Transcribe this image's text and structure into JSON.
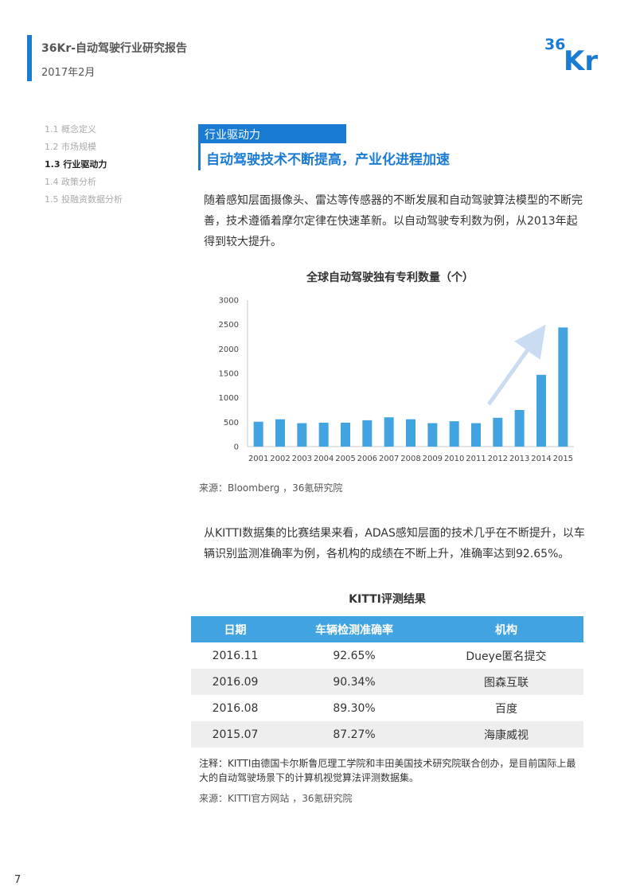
{
  "header": {
    "title": "36Kr-自动驾驶行业研究报告",
    "date": "2017年2月",
    "logo_top": "36",
    "logo_main": "Kr",
    "logo_color": "#1a7bd3"
  },
  "toc": [
    {
      "label": "1.1 概念定义"
    },
    {
      "label": "1.2 市场规模"
    },
    {
      "label": "1.3 行业驱动力"
    },
    {
      "label": "1.4 政策分析"
    },
    {
      "label": "1.5 投融资数据分析"
    }
  ],
  "section": {
    "label": "行业驱动力",
    "title": "自动驾驶技术不断提高，产业化进程加速"
  },
  "paragraphs": {
    "p1": "随着感知层面摄像头、雷达等传感器的不断发展和自动驾驶算法模型的不断完善，技术遵循着摩尔定律在快速革新。以自动驾驶专利数为例，从2013年起得到较大提升。",
    "p2": "从KITTI数据集的比赛结果来看，ADAS感知层面的技术几乎在不断提升，以车辆识别监测准确率为例，各机构的成绩在不断上升，准确率达到92.65%。"
  },
  "chart_data": {
    "type": "bar",
    "title": "全球自动驾驶独有专利数量（个）",
    "categories": [
      "2001",
      "2002",
      "2003",
      "2004",
      "2005",
      "2006",
      "2007",
      "2008",
      "2009",
      "2010",
      "2011",
      "2012",
      "2013",
      "2014",
      "2015"
    ],
    "values": [
      510,
      560,
      480,
      490,
      490,
      540,
      600,
      560,
      480,
      520,
      480,
      590,
      750,
      1470,
      2440
    ],
    "ylim": [
      0,
      3000
    ],
    "yticks": [
      "0",
      "500",
      "1000",
      "1500",
      "2000",
      "2500",
      "3000"
    ],
    "grid": false,
    "bar_color": "#41a4e0",
    "annotation": "trend-arrow"
  },
  "sources": {
    "chart": "来源：Bloomberg ，36氪研究院",
    "table": "来源：KITTI官方网站 ，36氪研究院"
  },
  "table": {
    "title": "KITTI评测结果",
    "headers": [
      "日期",
      "车辆检测准确率",
      "机构"
    ],
    "rows": [
      [
        "2016.11",
        "92.65%",
        "Dueye匿名提交"
      ],
      [
        "2016.09",
        "90.34%",
        "图森互联"
      ],
      [
        "2016.08",
        "89.30%",
        "百度"
      ],
      [
        "2015.07",
        "87.27%",
        "海康威视"
      ]
    ],
    "header_color": "#41a4e0"
  },
  "note": "注释：KITTI由德国卡尔斯鲁厄理工学院和丰田美国技术研究院联合创办，是目前国际上最大的自动驾驶场景下的计算机视觉算法评测数据集。",
  "page_number": "7"
}
